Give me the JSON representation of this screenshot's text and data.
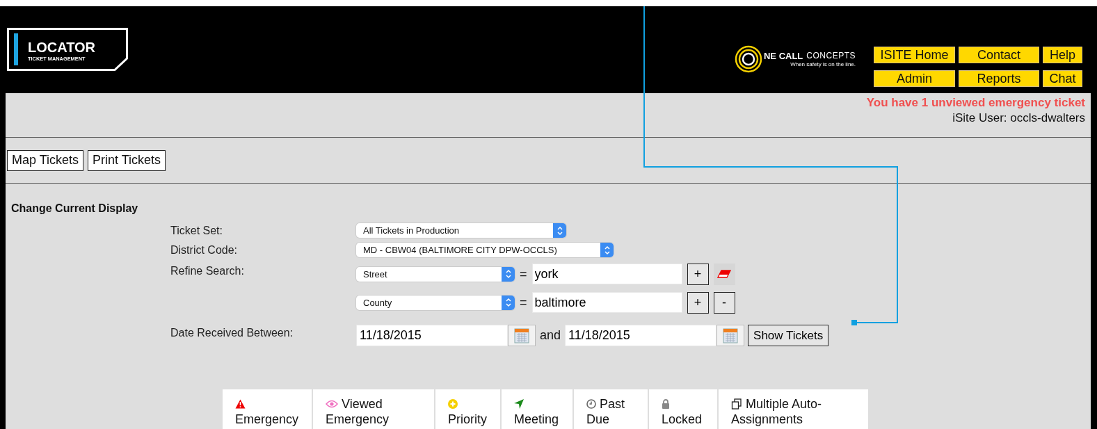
{
  "logo": {
    "title": "LOCATOR",
    "subtitle": "TICKET MANAGEMENT"
  },
  "partner_logo": {
    "brand": "NE CALL",
    "brand_rest": "CONCEPTS",
    "tagline": "When safety is on the line."
  },
  "nav_buttons": [
    "ISITE Home",
    "Contact",
    "Help",
    "Admin",
    "Reports",
    "Chat"
  ],
  "alert": "You have 1 unviewed emergency ticket",
  "user": "iSite User: occls-dwalters",
  "toolbar": [
    "Map Tickets",
    "Print Tickets"
  ],
  "form": {
    "title": "Change Current Display",
    "ticket_set": {
      "label": "Ticket Set:",
      "value": "All Tickets in Production"
    },
    "district_code": {
      "label": "District Code:",
      "value": "MD - CBW04 (BALTIMORE CITY DPW-OCCLS)"
    },
    "refine_search": {
      "label": "Refine Search:",
      "filters": [
        {
          "field": "Street",
          "operator": "=",
          "value": "york",
          "actions": [
            {
              "kind": "add",
              "text": "+"
            },
            {
              "kind": "clear"
            }
          ]
        },
        {
          "field": "County",
          "operator": "=",
          "value": "baltimore",
          "actions": [
            {
              "kind": "add",
              "text": "+"
            },
            {
              "kind": "remove",
              "text": "-"
            }
          ]
        }
      ]
    },
    "date_range": {
      "label": "Date Received Between:",
      "from": "11/18/2015",
      "joiner": "and",
      "to": "11/18/2015",
      "button": "Show Tickets"
    }
  },
  "legend": [
    {
      "kind": "emergency",
      "lines": [
        "Emergency"
      ]
    },
    {
      "kind": "viewed",
      "lines": [
        "Viewed",
        "Emergency"
      ]
    },
    {
      "kind": "priority",
      "lines": [
        "Priority"
      ]
    },
    {
      "kind": "meeting",
      "lines": [
        "Meeting"
      ]
    },
    {
      "kind": "past_due",
      "lines": [
        "Past",
        "Due"
      ]
    },
    {
      "kind": "locked",
      "lines": [
        "Locked"
      ]
    },
    {
      "kind": "multiple",
      "lines": [
        "Multiple Auto-",
        "Assignments"
      ]
    }
  ]
}
